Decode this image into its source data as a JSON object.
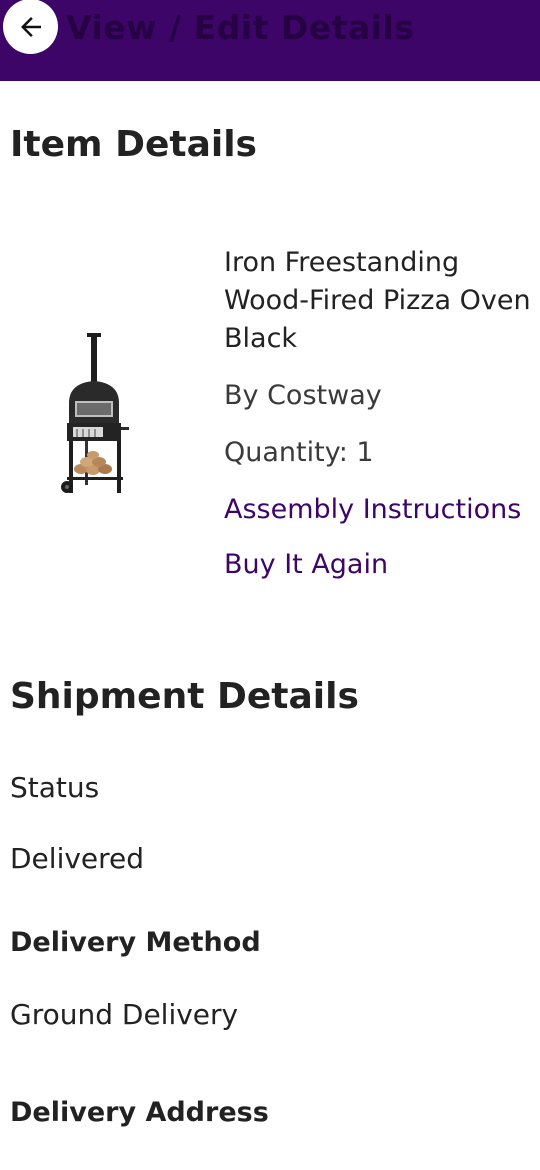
{
  "header": {
    "title": "View / Edit Details",
    "back_icon": "arrow-left-icon",
    "background_color": "#3d0567"
  },
  "item_details": {
    "section_title": "Item Details",
    "product": {
      "image_icon": "pizza-oven-image",
      "name_line1": "Iron Freestanding",
      "name_line2": "Wood-Fired Pizza Oven",
      "name_line3": "Black",
      "brand": "By Costway",
      "quantity": "Quantity: 1",
      "assembly_link": "Assembly Instructions",
      "buy_again_link": "Buy It Again"
    }
  },
  "shipment_details": {
    "section_title": "Shipment Details",
    "status_label": "Status",
    "status_value": "Delivered",
    "delivery_method_label": "Delivery Method",
    "delivery_method_value": "Ground Delivery",
    "delivery_address_label": "Delivery Address"
  }
}
